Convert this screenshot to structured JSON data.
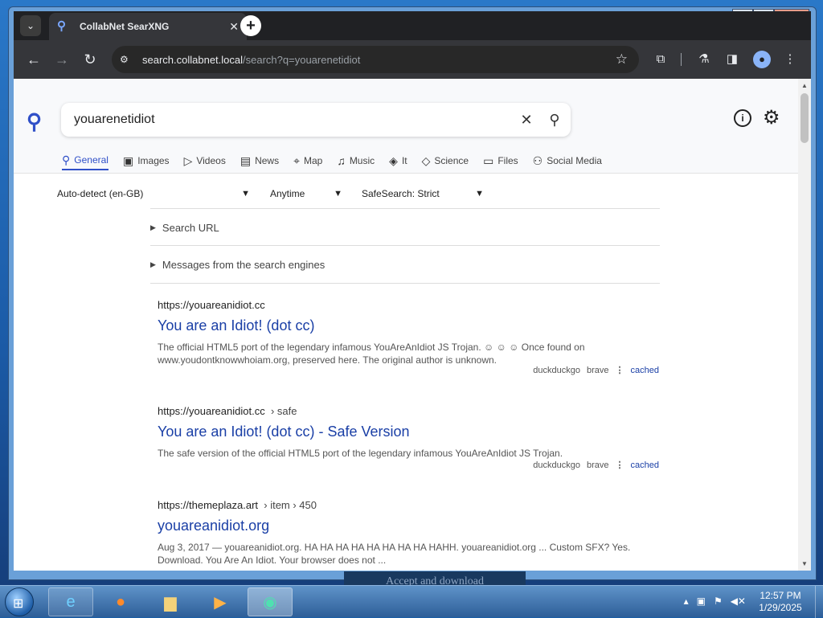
{
  "browser": {
    "tab_title": "CollabNet SearXNG",
    "tab_close": "✕",
    "new_tab": "+",
    "url_host": "search.collabnet.local",
    "url_path": "/search?q=youarenetidiot"
  },
  "window_controls": {
    "minimize": "—",
    "maximize": "□",
    "close": "✕"
  },
  "search": {
    "query": "youarenetidiot",
    "categories": [
      {
        "label": "General",
        "icon": "search-icon",
        "active": true
      },
      {
        "label": "Images",
        "icon": "image-icon"
      },
      {
        "label": "Videos",
        "icon": "play-icon"
      },
      {
        "label": "News",
        "icon": "newspaper-icon"
      },
      {
        "label": "Map",
        "icon": "map-pin-icon"
      },
      {
        "label": "Music",
        "icon": "music-note-icon"
      },
      {
        "label": "It",
        "icon": "layers-icon"
      },
      {
        "label": "Science",
        "icon": "graduation-cap-icon"
      },
      {
        "label": "Files",
        "icon": "files-icon"
      },
      {
        "label": "Social Media",
        "icon": "users-icon"
      }
    ],
    "filters": {
      "language": "Auto-detect (en-GB)",
      "time": "Anytime",
      "safesearch": "SafeSearch: Strict"
    },
    "details": {
      "search_url": "Search URL",
      "messages": "Messages from the search engines"
    }
  },
  "results": [
    {
      "url": "https://youareanidiot.cc",
      "crumb": "",
      "title": "You are an Idiot! (dot cc)",
      "snippet": "The official HTML5 port of the legendary infamous YouAreAnIdiot JS Trojan. ☺ ☺ ☺ Once found on www.youdontknowwhoiam.org, preserved here. The original author is unknown.",
      "engines": [
        "duckduckgo",
        "brave"
      ],
      "cached": "cached"
    },
    {
      "url": "https://youareanidiot.cc",
      "crumb": "› safe",
      "title": "You are an Idiot! (dot cc) - Safe Version",
      "snippet": "The safe version of the official HTML5 port of the legendary infamous YouAreAnIdiot JS Trojan.",
      "engines": [
        "duckduckgo",
        "brave"
      ],
      "cached": "cached"
    },
    {
      "url": "https://themeplaza.art",
      "crumb": "› item › 450",
      "title": "youareanidiot.org",
      "snippet": "Aug 3, 2017 — youareanidiot.org. HA HA HA HA HA HA HA HA HAHH. youareanidiot.org ... Custom SFX? Yes. Download. You Are An Idiot. Your browser does not ..."
    }
  ],
  "overlay": {
    "cookie_button": "Accept and download"
  },
  "taskbar": {
    "time": "12:57 PM",
    "date": "1/29/2025"
  }
}
